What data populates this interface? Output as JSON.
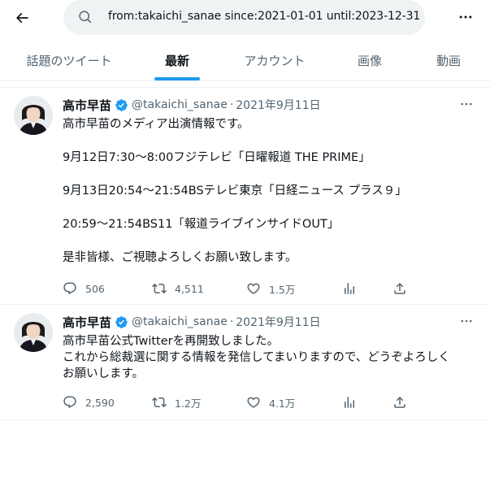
{
  "search": {
    "query": "from:takaichi_sanae since:2021-01-01 until:2023-12-31"
  },
  "tabs": [
    {
      "label": "話題のツイート"
    },
    {
      "label": "最新"
    },
    {
      "label": "アカウント"
    },
    {
      "label": "画像"
    },
    {
      "label": "動画"
    }
  ],
  "active_tab": "最新",
  "colors": {
    "accent": "#1d9bf0",
    "text_primary": "#0f1419",
    "text_secondary": "#536471",
    "search_bg": "#eff3f4"
  },
  "tweets": [
    {
      "name": "高市早苗",
      "handle": "@takaichi_sanae",
      "separator": "·",
      "date": "2021年9月11日",
      "lines": [
        "高市早苗のメディア出演情報です。",
        "",
        "9月12日7:30〜8:00フジテレビ「日曜報道 THE PRIME」",
        "",
        "9月13日20:54〜21:54BSテレビ東京「日経ニュース プラス９」",
        "",
        "20:59〜21:54BS11「報道ライブインサイドOUT」",
        "",
        "是非皆様、ご視聴よろしくお願い致します。"
      ],
      "replies": "506",
      "retweets": "4,511",
      "likes": "1.5万"
    },
    {
      "name": "高市早苗",
      "handle": "@takaichi_sanae",
      "separator": "·",
      "date": "2021年9月11日",
      "lines": [
        "高市早苗公式Twitterを再開致しました。",
        "これから総裁選に関する情報を発信してまいりますので、どうぞよろしく",
        "お願いします。"
      ],
      "replies": "2,590",
      "retweets": "1.2万",
      "likes": "4.1万"
    }
  ]
}
